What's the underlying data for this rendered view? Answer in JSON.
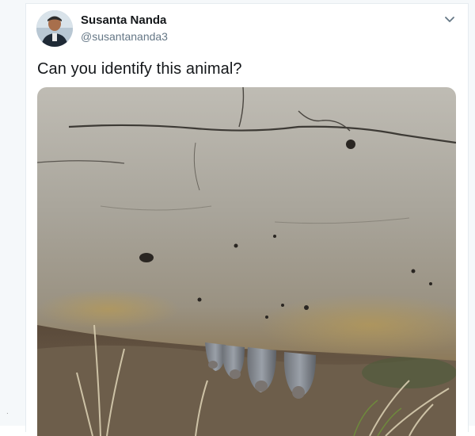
{
  "author": {
    "name": "Susanta Nanda",
    "handle": "@susantananda3",
    "avatar_icon": "avatar-person-icon"
  },
  "tweet": {
    "text": "Can you identify this animal?"
  },
  "icons": {
    "menu": "chevron-down-icon"
  },
  "colors": {
    "text_primary": "#14171a",
    "text_secondary": "#657786",
    "border": "#e6ecf0"
  }
}
